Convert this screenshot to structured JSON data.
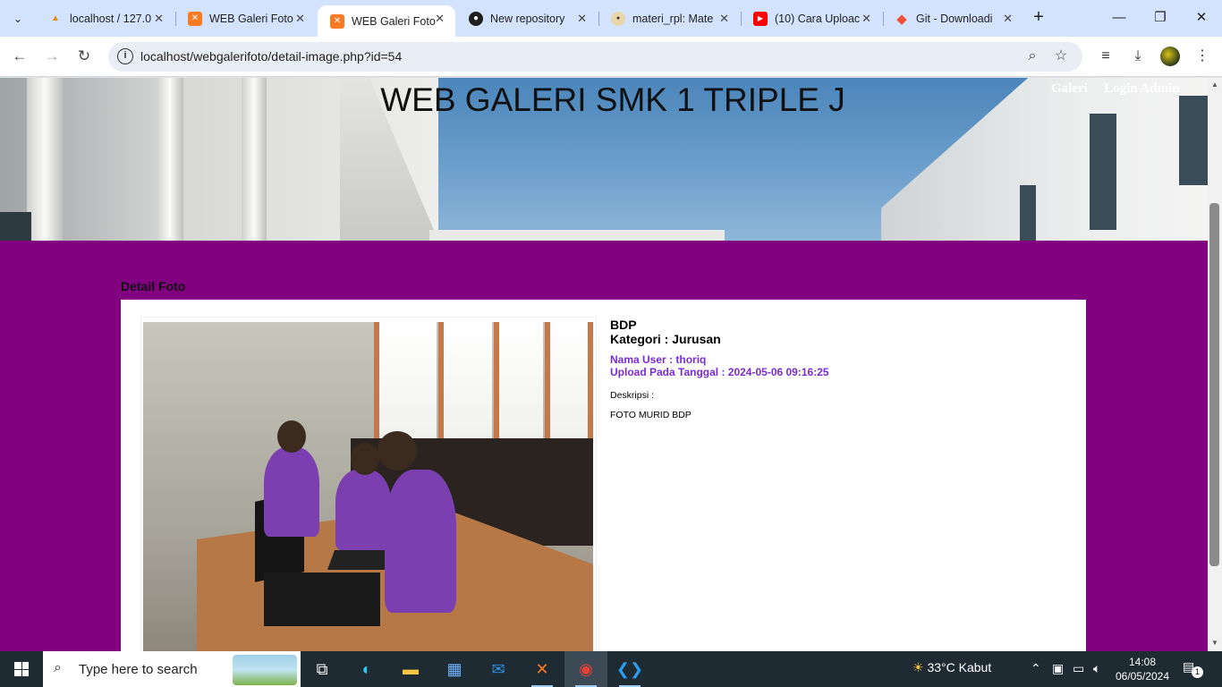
{
  "browser": {
    "tabs": [
      {
        "label": "localhost / 127.0",
        "favicon": "phpmyadmin-icon"
      },
      {
        "label": "WEB Galeri Foto",
        "favicon": "xampp-icon"
      },
      {
        "label": "WEB Galeri Foto",
        "favicon": "xampp-icon",
        "active": true
      },
      {
        "label": "New repository",
        "favicon": "github-icon"
      },
      {
        "label": "materi_rpl: Mate",
        "favicon": "ppt-icon"
      },
      {
        "label": "(10) Cara Uploac",
        "favicon": "youtube-icon"
      },
      {
        "label": "Git - Downloadi",
        "favicon": "git-icon"
      }
    ],
    "url": "localhost/webgalerifoto/detail-image.php?id=54"
  },
  "site": {
    "header_title": "WEB GALERI SMK 1 TRIPLE J",
    "nav": [
      "Galeri",
      "Login Admin"
    ]
  },
  "detail": {
    "section_title": "Detail Foto",
    "title": "BDP",
    "category": "Kategori : Jurusan",
    "user": "Nama User : thoriq",
    "uploaded": "Upload Pada Tanggal : 2024-05-06 09:16:25",
    "description_label": "Deskripsi :",
    "description": "FOTO MURID BDP"
  },
  "taskbar": {
    "search_placeholder": "Type here to search",
    "weather": "33°C  Kabut",
    "time": "14:08",
    "date": "06/05/2024",
    "notifications": "1"
  },
  "colors": {
    "page_bg": "#800080",
    "accent_text": "#7b2bd6",
    "tabbar": "#d3e3fd"
  }
}
